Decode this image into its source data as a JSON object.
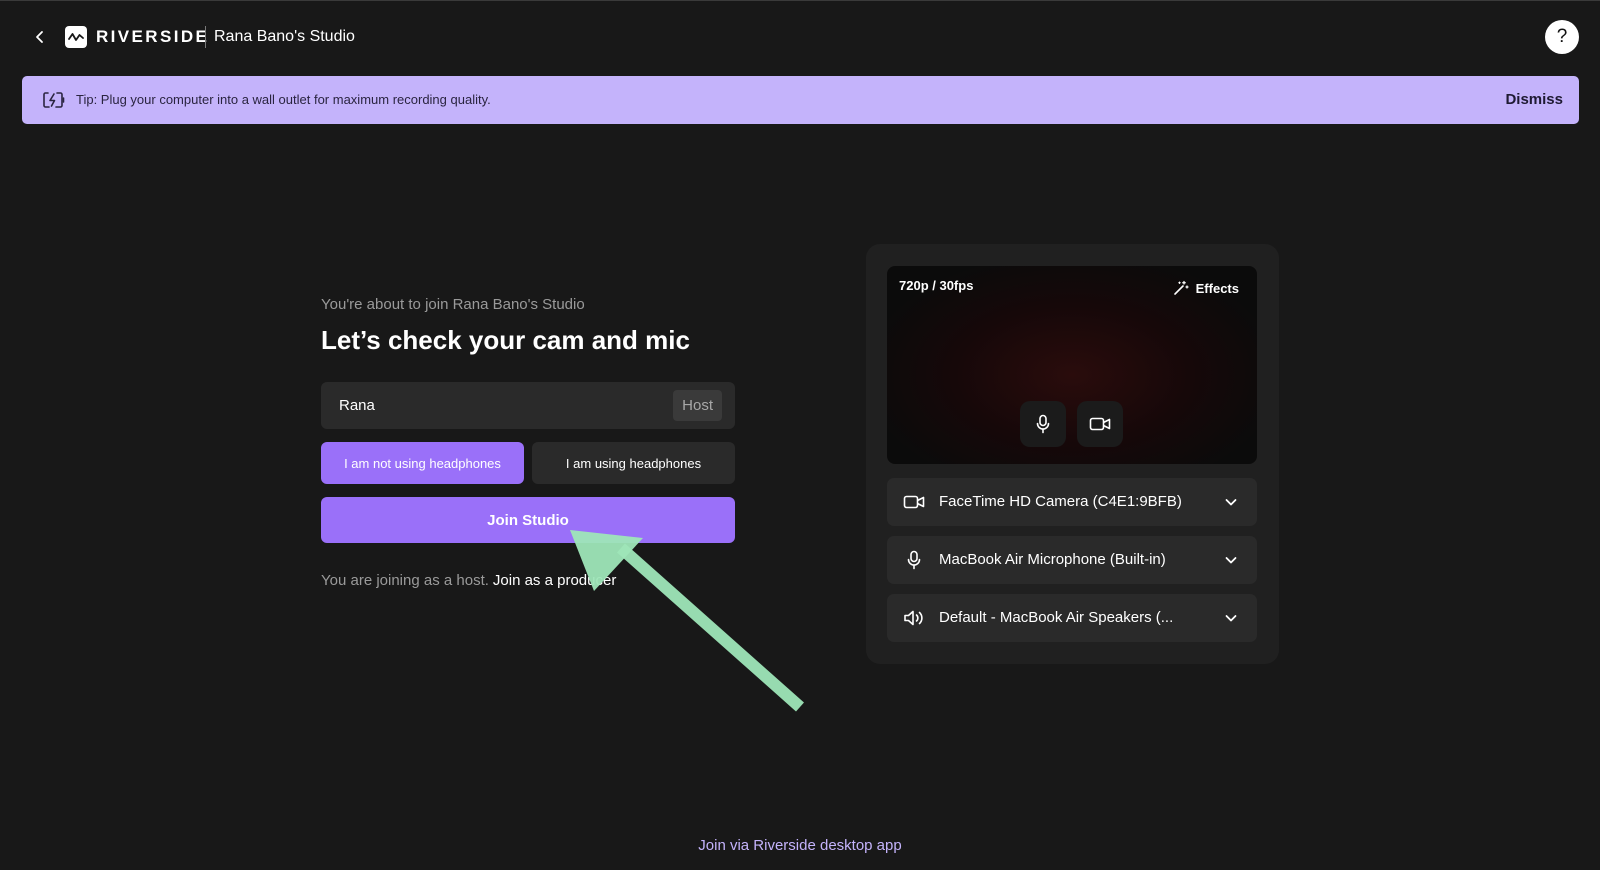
{
  "header": {
    "brand": "RIVERSIDE",
    "studio_name": "Rana Bano's Studio",
    "help_label": "?"
  },
  "tip": {
    "text": "Tip: Plug your computer into a wall outlet for maximum recording quality.",
    "dismiss_label": "Dismiss",
    "icon": "battery-charging-icon"
  },
  "join_form": {
    "joining_label": "You're about to join Rana Bano's Studio",
    "heading": "Let’s check your cam and mic",
    "name_value": "Rana",
    "role_tag": "Host",
    "headphones_no_label": "I am not using headphones",
    "headphones_yes_label": "I am using headphones",
    "selected_headphones_option": "I am not using headphones",
    "join_button_label": "Join Studio",
    "host_note": "You are joining as a host.",
    "producer_link": "Join as a producer"
  },
  "device_panel": {
    "resolution": "720p / 30fps",
    "effects_label": "Effects",
    "camera": "FaceTime HD Camera (C4E1:9BFB)",
    "microphone": "MacBook Air Microphone (Built-in)",
    "speaker": "Default - MacBook Air Speakers (..."
  },
  "footer": {
    "desktop_app_link": "Join via Riverside desktop app"
  },
  "colors": {
    "background": "#181818",
    "accent": "#9a70f9",
    "tip_banner": "#c4b3fb",
    "annotation_arrow": "#9ee6b8"
  }
}
